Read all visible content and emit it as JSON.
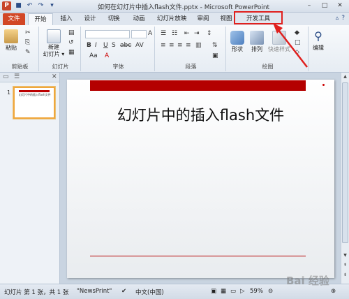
{
  "window": {
    "title": "如何在幻灯片中插入flash文件.pptx - Microsoft PowerPoint",
    "app_icon": "P",
    "controls": [
      "–",
      "□",
      "✕"
    ]
  },
  "quick_access": [
    "save-icon",
    "undo-icon",
    "redo-icon"
  ],
  "tabs": [
    "文件",
    "开始",
    "插入",
    "设计",
    "切换",
    "动画",
    "幻灯片放映",
    "审阅",
    "视图",
    "开发工具"
  ],
  "ribbon": {
    "groups": {
      "clipboard": "剪贴板",
      "slides": "幻灯片",
      "font": "字体",
      "paragraph": "段落",
      "drawing": "绘图"
    },
    "paste": "粘贴",
    "new_slide": "新建\n幻灯片 ▾",
    "shapes": "形状",
    "arrange": "排列",
    "quick_styles": "快速样式",
    "editing": "编辑",
    "font_buttons": [
      "B",
      "I",
      "U",
      "S",
      "abc",
      "AV",
      "Aa",
      "A"
    ],
    "font_size_buttons": [
      "A",
      "A"
    ]
  },
  "slide": {
    "number": "1",
    "title": "幻灯片中的插入flash文件",
    "thumb_title": "幻灯片中的插入flash文件"
  },
  "status": {
    "slide_info": "幻灯片 第 1 张，共 1 张",
    "theme": "\"NewsPrint\"",
    "language": "中文(中国)",
    "zoom": "59%"
  },
  "watermark": "Bai 经验",
  "colors": {
    "file_tab": "#d24726",
    "highlight": "#e0201e",
    "slide_accent": "#b40000"
  }
}
